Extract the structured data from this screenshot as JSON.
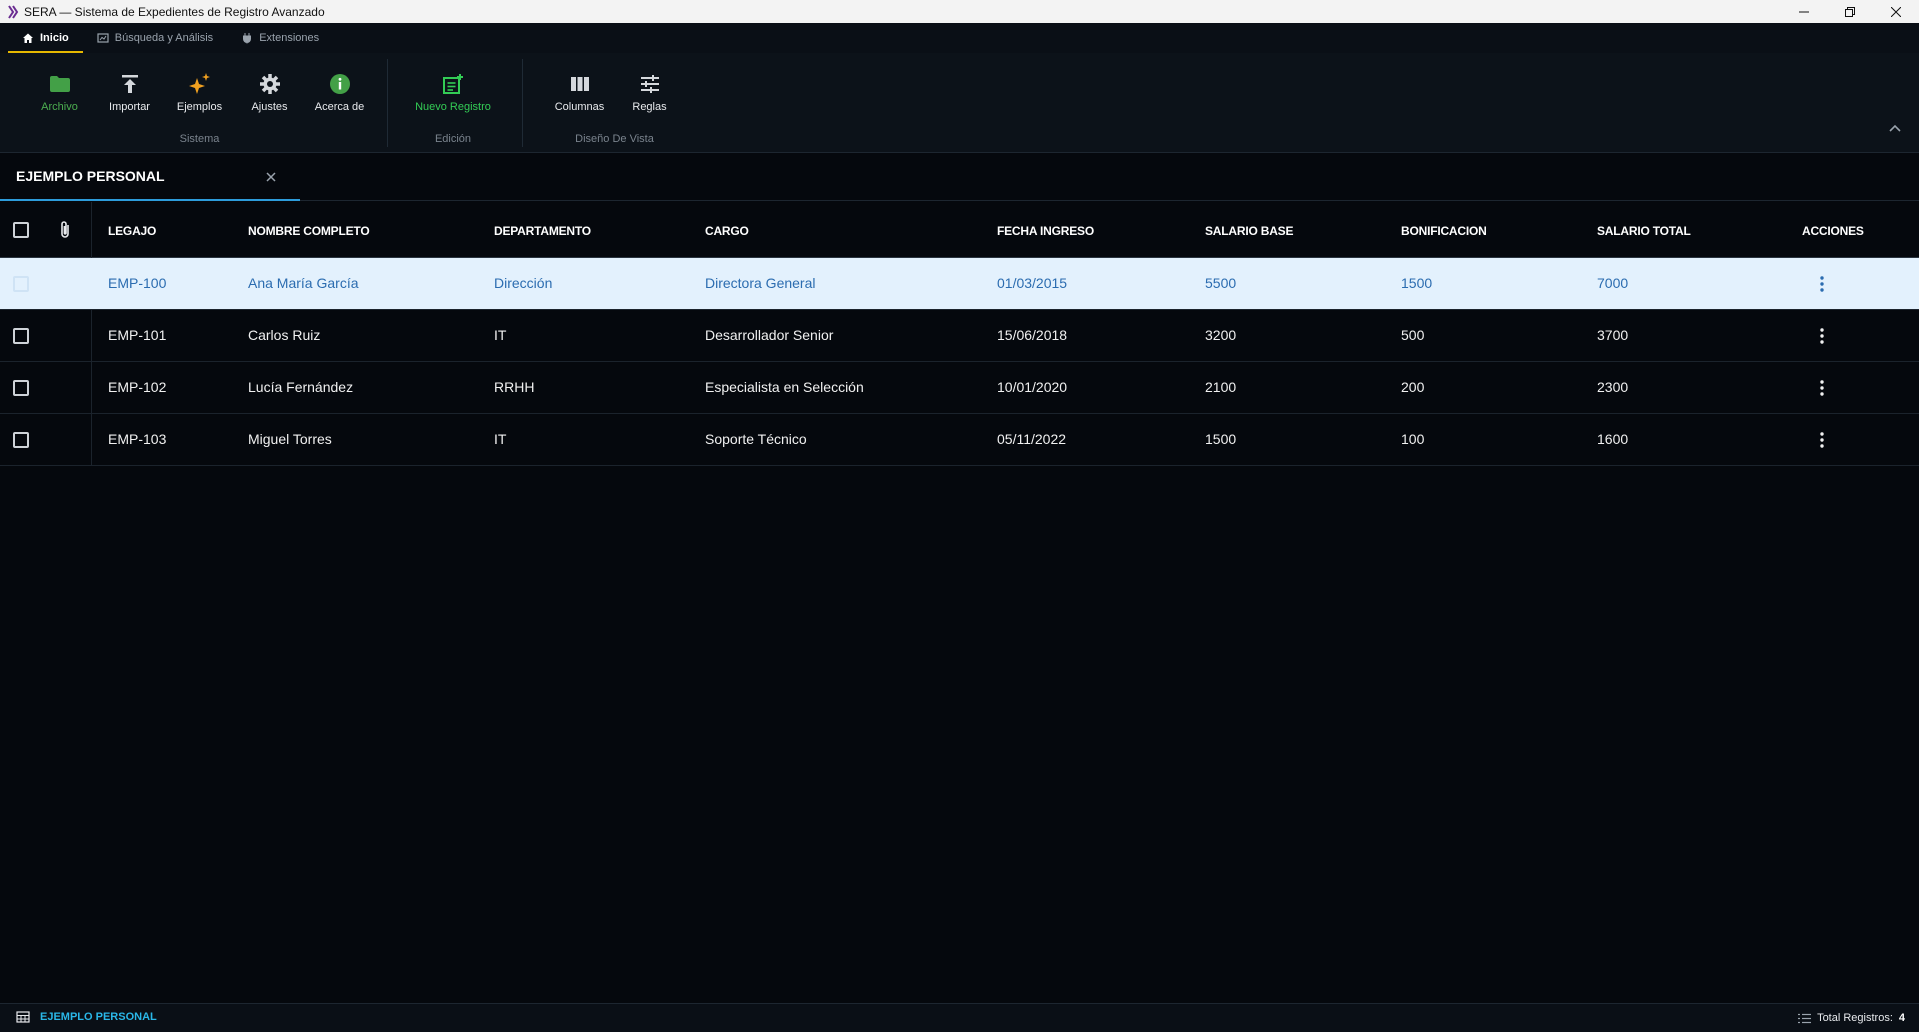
{
  "window": {
    "title": "SERA — Sistema de Expedientes de Registro Avanzado"
  },
  "ribbon_tabs": [
    {
      "label": "Inicio",
      "icon": "home-icon",
      "active": true
    },
    {
      "label": "Búsqueda y Análisis",
      "icon": "analysis-icon",
      "active": false
    },
    {
      "label": "Extensiones",
      "icon": "plugin-icon",
      "active": false
    }
  ],
  "ribbon": {
    "groups": [
      {
        "label": "Sistema",
        "buttons": [
          {
            "label": "Archivo",
            "icon": "folder-icon"
          },
          {
            "label": "Importar",
            "icon": "upload-icon"
          },
          {
            "label": "Ejemplos",
            "icon": "sparkle-icon"
          },
          {
            "label": "Ajustes",
            "icon": "gear-icon"
          },
          {
            "label": "Acerca de",
            "icon": "info-icon"
          }
        ]
      },
      {
        "label": "Edición",
        "buttons": [
          {
            "label": "Nuevo Registro",
            "icon": "add-record-icon"
          }
        ]
      },
      {
        "label": "Diseño De Vista",
        "buttons": [
          {
            "label": "Columnas",
            "icon": "columns-icon"
          },
          {
            "label": "Reglas",
            "icon": "sliders-icon"
          }
        ]
      }
    ]
  },
  "document_tab": {
    "name": "EJEMPLO PERSONAL"
  },
  "table": {
    "columns": [
      "LEGAJO",
      "NOMBRE COMPLETO",
      "DEPARTAMENTO",
      "CARGO",
      "FECHA INGRESO",
      "SALARIO BASE",
      "BONIFICACION",
      "SALARIO TOTAL",
      "ACCIONES"
    ],
    "rows": [
      [
        "EMP-100",
        "Ana María García",
        "Dirección",
        "Directora General",
        "01/03/2015",
        "5500",
        "1500",
        "7000"
      ],
      [
        "EMP-101",
        "Carlos Ruiz",
        "IT",
        "Desarrollador Senior",
        "15/06/2018",
        "3200",
        "500",
        "3700"
      ],
      [
        "EMP-102",
        "Lucía Fernández",
        "RRHH",
        "Especialista en Selección",
        "10/01/2020",
        "2100",
        "200",
        "2300"
      ],
      [
        "EMP-103",
        "Miguel Torres",
        "IT",
        "Soporte Técnico",
        "05/11/2022",
        "1500",
        "100",
        "1600"
      ]
    ],
    "selected_row": 0
  },
  "statusbar": {
    "dataset": "EJEMPLO PERSONAL",
    "total_label": "Total Registros:",
    "total_value": "4"
  },
  "colors": {
    "accent_tab": "#e6b800",
    "accent_blue": "#2d9cdb",
    "selected_row_bg": "#e3f1fd",
    "green": "#4caf50"
  }
}
